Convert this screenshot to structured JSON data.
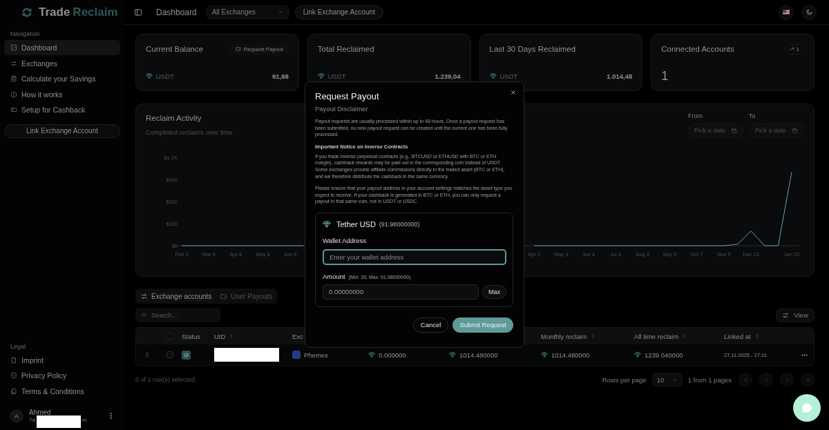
{
  "sidebar": {
    "logo": {
      "word_1": "Trade",
      "word_2": "Reclaim"
    },
    "nav_title": "Navigation",
    "nav_items": [
      {
        "label": "Dashboard",
        "kind": "dashboard",
        "selected": true
      },
      {
        "label": "Exchanges",
        "kind": "swap",
        "selected": false
      },
      {
        "label": "Calculate your Savings",
        "kind": "calculator",
        "selected": false
      },
      {
        "label": "How it works",
        "kind": "info",
        "selected": false
      },
      {
        "label": "Setup for Cashback",
        "kind": "card",
        "selected": false
      }
    ],
    "link_button": "Link Exchange Account",
    "legal_title": "Legal",
    "legal_items": [
      {
        "label": "Imprint",
        "kind": "file"
      },
      {
        "label": "Privacy Policy",
        "kind": "shield"
      },
      {
        "label": "Terms & Conditions",
        "kind": "files"
      }
    ],
    "user": {
      "initial": "A",
      "name": "Ahmed",
      "email_start": "7a",
      "email_end": "m"
    }
  },
  "header": {
    "page": "Dashboard",
    "exchange_select": "All Exchanges",
    "link_button": "Link Exchange Account"
  },
  "stats": [
    {
      "title": "Current Balance",
      "kind": "currency",
      "action": "Request Payout",
      "currency": "USDT",
      "value": "91,98"
    },
    {
      "title": "Total Reclaimed",
      "kind": "currency",
      "currency": "USDT",
      "value": "1.239,04"
    },
    {
      "title": "Last 30 Days Reclaimed",
      "kind": "currency",
      "currency": "USDT",
      "value": "1.014,48"
    },
    {
      "title": "Connected Accounts",
      "kind": "count",
      "badge": "1",
      "value": "1"
    }
  ],
  "activity": {
    "title": "Reclaim Activity",
    "subtitle": "Completed reclaims over time",
    "from": {
      "label": "From",
      "placeholder": "Pick a date"
    },
    "to": {
      "label": "To",
      "placeholder": "Pick a date"
    },
    "chart_data": {
      "type": "line",
      "ylim": [
        0,
        1200
      ],
      "yticks": [
        {
          "value": 0,
          "label": "$0"
        },
        {
          "value": 300,
          "label": "$300"
        },
        {
          "value": 600,
          "label": "$600"
        },
        {
          "value": 900,
          "label": "$900"
        },
        {
          "value": 1200,
          "label": "$1.2K"
        }
      ],
      "categories": [
        "Feb 3",
        null,
        "Mar 6",
        null,
        "Apr 6",
        null,
        "May 8",
        null,
        "Jun 9",
        null,
        null,
        null,
        null,
        null,
        null,
        null,
        null,
        null,
        null,
        null,
        null,
        null,
        null,
        null,
        null,
        null,
        "Apr 1",
        null,
        "May 3",
        null,
        "Jun 4",
        null,
        "Jul 3",
        null,
        "Aug 3",
        null,
        "Sep 5",
        null,
        "Oct 7",
        null,
        "Nov 9",
        null,
        "Dec 13",
        null,
        null,
        "Jan 23"
      ],
      "series": [
        {
          "color": "#5fa8a8",
          "values": [
            0,
            0,
            0,
            0,
            0,
            0,
            0,
            0,
            0,
            0,
            null,
            null,
            null,
            null,
            null,
            null,
            null,
            null,
            null,
            null,
            null,
            null,
            null,
            null,
            null,
            null,
            0,
            0,
            0,
            0,
            0,
            0,
            0,
            0,
            0,
            0,
            0,
            0,
            0,
            0,
            0,
            20,
            200,
            0,
            0,
            1000
          ]
        }
      ]
    }
  },
  "tabs": [
    {
      "label": "Exchange accounts",
      "kind": "swap",
      "selected": true
    },
    {
      "label": "User Payouts",
      "kind": "wallet",
      "selected": false
    }
  ],
  "search": {
    "placeholder": "Search..."
  },
  "view_button": "View",
  "table": {
    "all_selected": false,
    "columns": [
      {
        "label": "Status",
        "sortable": false
      },
      {
        "label": "UID",
        "sortable": true
      },
      {
        "label": "Exc"
      },
      {},
      {},
      {
        "label": "Monthly reclaim",
        "sortable": true
      },
      {
        "label": "All time reclaim",
        "sortable": true
      },
      {
        "label": "Linked at",
        "sortable": true
      }
    ],
    "rows": [
      {
        "selected": false,
        "exchange": "Phemex",
        "amounts": [
          "0.000000",
          "1014.480000",
          "1014.480000",
          "1239.040000"
        ],
        "linked_at": "27.11.2025 - 17:11"
      }
    ]
  },
  "footer": {
    "selection": "0 of 1 row(s) selected.",
    "rows_label": "Rows per page",
    "rows_value": "10",
    "page_info": "1 from 1 pages"
  },
  "dialog": {
    "title": "Request Payout",
    "subtitle": "Payout Disclaimer",
    "paragraphs": [
      {
        "kind": "text",
        "text": "Payout requests are usually processed within up to 48 hours. Once a payout request has been submitted, no new payout request can be created until the current one has been fully processed."
      },
      {
        "kind": "heading",
        "text": "Important Notice on Inverse Contracts"
      },
      {
        "kind": "text",
        "text": "If you trade inverse perpetual contracts (e.g., BTCUSD or ETHUSD with BTC or ETH margin), cashback rewards may be paid out in the corresponding coin instead of USDT. Some exchanges provide affiliate commissions directly in the traded asset (BTC or ETH), and we therefore distribute the cashback in the same currency."
      },
      {
        "kind": "text",
        "text": "Please ensure that your payout address in your account settings matches the asset type you expect to receive. If your cashback is generated in BTC or ETH, you can only request a payout in that same coin, not in USDT or USDC."
      }
    ],
    "asset": {
      "name": "Tether USD",
      "amount": "(91.98000000)"
    },
    "wallet": {
      "label": "Wallet Address",
      "placeholder": "Enter your wallet address",
      "focused": true
    },
    "amount": {
      "label": "Amount",
      "hint": "(Min: 20, Max: 91.98000000)",
      "placeholder": "0.00000000",
      "max_button": "Max"
    },
    "cancel_button": "Cancel",
    "submit_button": "Submit Request"
  }
}
